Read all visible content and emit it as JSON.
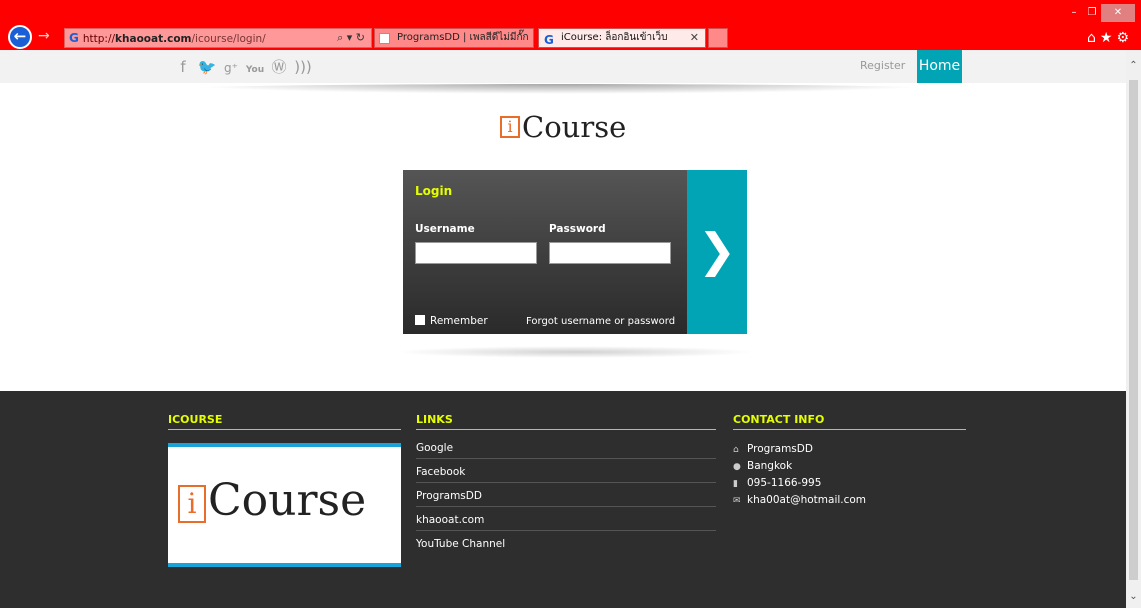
{
  "browser": {
    "url_prefix": "http://",
    "url_domain": "khaooat.com",
    "url_path": "/icourse/login/",
    "tabs": [
      {
        "label": "ProgramsDD | เพลสีดีไม่มีกั๊ก"
      },
      {
        "label": "iCourse: ล็อกอินเข้าเว็บ"
      }
    ],
    "icons": {
      "back": "←",
      "forward": "→",
      "search": "⌕ ▾ ↻",
      "home": "⌂",
      "favorites": "★",
      "settings": "⚙"
    }
  },
  "nav": {
    "social_icons": [
      "facebook-icon",
      "twitter-icon",
      "googleplus-icon",
      "youtube-icon",
      "wordpress-icon",
      "rss-icon"
    ],
    "register": "Register",
    "home": "Home"
  },
  "logo": {
    "i": "i",
    "word": "Course"
  },
  "login": {
    "title": "Login",
    "username_label": "Username",
    "password_label": "Password",
    "username_value": "",
    "password_value": "",
    "remember": "Remember",
    "forgot": "Forgot username or password",
    "submit": "❯"
  },
  "footer": {
    "icourse_heading": "ICOURSE",
    "links_heading": "LINKS",
    "contact_heading": "CONTACT INFO",
    "links": [
      "Google",
      "Facebook",
      "ProgramsDD",
      "khaooat.com",
      "YouTube Channel"
    ],
    "contact": [
      "ProgramsDD",
      "Bangkok",
      "095-1166-995",
      "kha00at@hotmail.com"
    ]
  },
  "colors": {
    "chrome": "#ff0000",
    "accent": "#00a4b4",
    "highlight": "#e5ff00",
    "footer": "#2e2e2e"
  }
}
